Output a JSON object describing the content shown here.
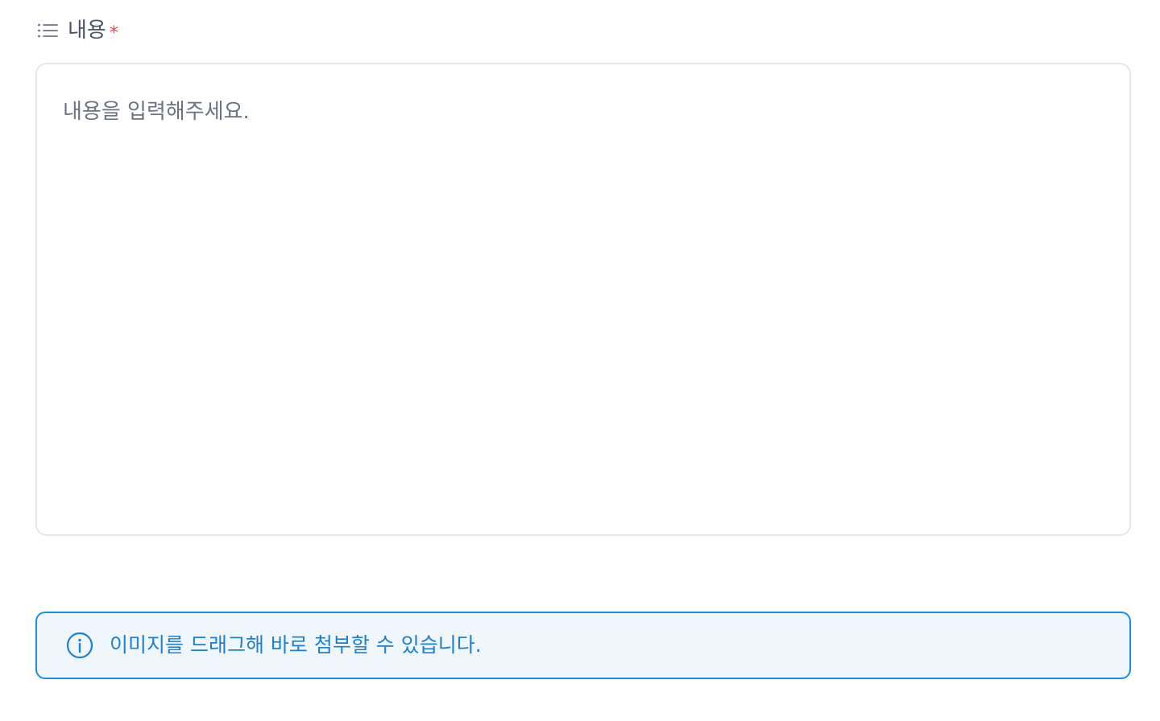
{
  "content_field": {
    "label": "내용",
    "required_mark": "*",
    "icon": "list-icon",
    "placeholder": "내용을 입력해주세요.",
    "value": ""
  },
  "info_notice": {
    "icon": "info-icon",
    "text": "이미지를 드래그해 바로 첨부할 수 있습니다."
  },
  "colors": {
    "label_text": "#4b5563",
    "required": "#ef4444",
    "border": "#e5e7eb",
    "info_border": "#1a8fe3",
    "info_background": "#eff7fd",
    "info_text": "#1e7fd0"
  }
}
